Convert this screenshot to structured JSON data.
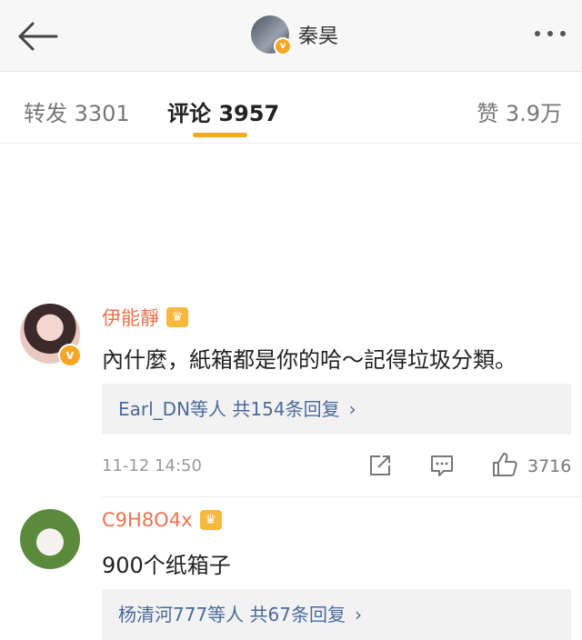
{
  "header": {
    "profile_name": "秦昊",
    "verified_mark": "v"
  },
  "tabs": {
    "repost": "转发 3301",
    "comment": "评论 3957",
    "like": "赞 3.9万",
    "underline_color": "#f5a623"
  },
  "comments": [
    {
      "author": "伊能靜",
      "text": "內什麼，紙箱都是你的哈～記得垃圾分類。",
      "replies": "Earl_DN等人 共154条回复",
      "time": "11-12 14:50",
      "likes": "3716",
      "verified_mark": "v"
    },
    {
      "author": "C9H8O4x",
      "text": "900个纸箱子",
      "replies": "杨清河777等人 共67条回复"
    }
  ],
  "icons": [
    "back-arrow-icon",
    "more-icon",
    "crown-icon",
    "share-icon",
    "comment-icon",
    "like-icon",
    "chevron-right-icon"
  ],
  "colors": {
    "author_name": "#eb7350",
    "reply_link": "#4a6b9b",
    "badge": "#f6a623"
  }
}
